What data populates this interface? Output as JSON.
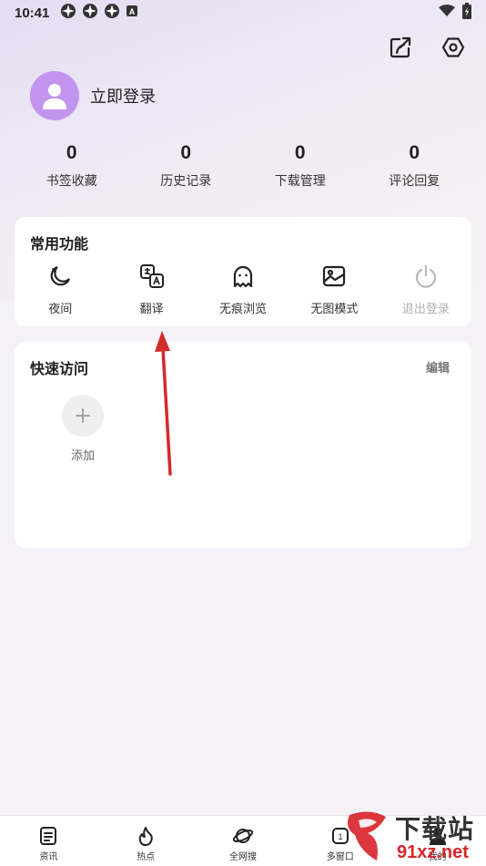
{
  "status_bar": {
    "time": "10:41",
    "notification_icons": [
      "pinwheel-icon",
      "pinwheel-icon",
      "pinwheel-icon",
      "a-badge-icon"
    ],
    "signal": "wifi-icon",
    "battery": "battery-icon"
  },
  "header": {
    "actions": [
      "share-icon",
      "settings-icon"
    ]
  },
  "profile": {
    "login_text": "立即登录"
  },
  "stats": [
    {
      "value": "0",
      "label": "书签收藏"
    },
    {
      "value": "0",
      "label": "历史记录"
    },
    {
      "value": "0",
      "label": "下载管理"
    },
    {
      "value": "0",
      "label": "评论回复"
    }
  ],
  "common_functions": {
    "title": "常用功能",
    "items": [
      {
        "label": "夜间",
        "icon": "moon-icon"
      },
      {
        "label": "翻译",
        "icon": "translate-icon"
      },
      {
        "label": "无痕浏览",
        "icon": "ghost-icon"
      },
      {
        "label": "无图模式",
        "icon": "image-icon"
      },
      {
        "label": "退出登录",
        "icon": "power-icon",
        "disabled": true
      }
    ]
  },
  "quick_access": {
    "title": "快速访问",
    "edit_label": "编辑",
    "add_label": "添加"
  },
  "bottom_nav": [
    {
      "label": "资讯",
      "icon": "news-icon"
    },
    {
      "label": "热点",
      "icon": "flame-icon"
    },
    {
      "label": "全网搜",
      "icon": "planet-icon"
    },
    {
      "label": "多窗口",
      "icon": "windows-icon",
      "count": "1"
    },
    {
      "label": "我的",
      "icon": "person-icon"
    }
  ],
  "watermark": {
    "line1": "下载站",
    "line2": "91xz.net"
  },
  "colors": {
    "avatar": "#c394ef",
    "arrow": "#d42a2a",
    "watermark_red": "#d9262c"
  }
}
